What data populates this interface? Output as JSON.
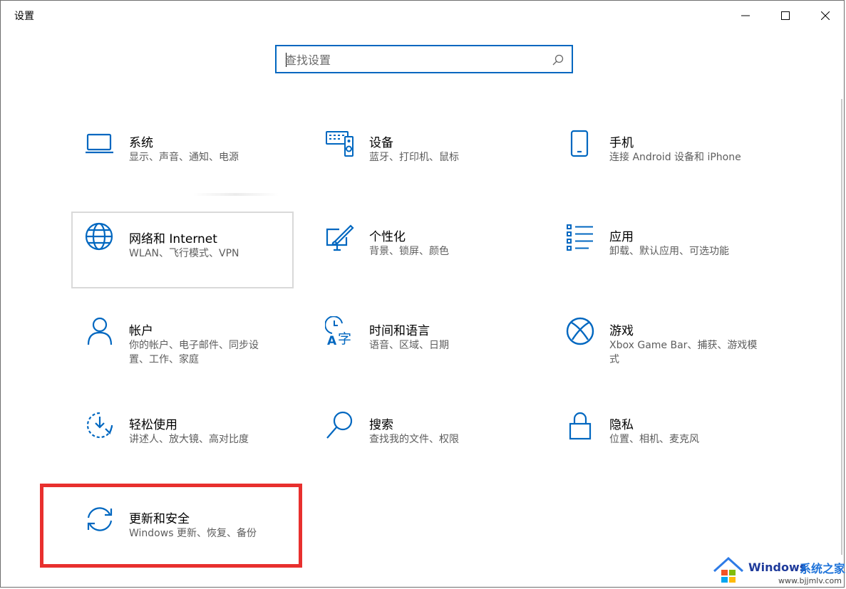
{
  "window": {
    "title": "设置"
  },
  "search": {
    "placeholder": "查找设置",
    "value": ""
  },
  "accent_color": "#0067c0",
  "highlight_color": "#e8302e",
  "tiles": [
    {
      "label": "系统",
      "desc": "显示、声音、通知、电源",
      "icon": "laptop-icon"
    },
    {
      "label": "设备",
      "desc": "蓝牙、打印机、鼠标",
      "icon": "devices-icon"
    },
    {
      "label": "手机",
      "desc": "连接 Android 设备和 iPhone",
      "icon": "phone-icon"
    },
    {
      "label": "网络和 Internet",
      "desc": "WLAN、飞行模式、VPN",
      "icon": "globe-icon"
    },
    {
      "label": "个性化",
      "desc": "背景、锁屏、颜色",
      "icon": "personalization-icon"
    },
    {
      "label": "应用",
      "desc": "卸载、默认应用、可选功能",
      "icon": "apps-list-icon"
    },
    {
      "label": "帐户",
      "desc": "你的帐户、电子邮件、同步设置、工作、家庭",
      "icon": "person-icon"
    },
    {
      "label": "时间和语言",
      "desc": "语音、区域、日期",
      "icon": "time-language-icon"
    },
    {
      "label": "游戏",
      "desc": "Xbox Game Bar、捕获、游戏模式",
      "icon": "xbox-icon"
    },
    {
      "label": "轻松使用",
      "desc": "讲述人、放大镜、高对比度",
      "icon": "ease-of-access-icon"
    },
    {
      "label": "搜索",
      "desc": "查找我的文件、权限",
      "icon": "search-magnifier-icon"
    },
    {
      "label": "隐私",
      "desc": "位置、相机、麦克风",
      "icon": "lock-icon"
    },
    {
      "label": "更新和安全",
      "desc": "Windows 更新、恢复、备份",
      "icon": "sync-arrows-icon"
    }
  ],
  "watermark": {
    "title": "Windows",
    "subtitle": "系统之家",
    "url": "www.bjjmlv.com"
  }
}
